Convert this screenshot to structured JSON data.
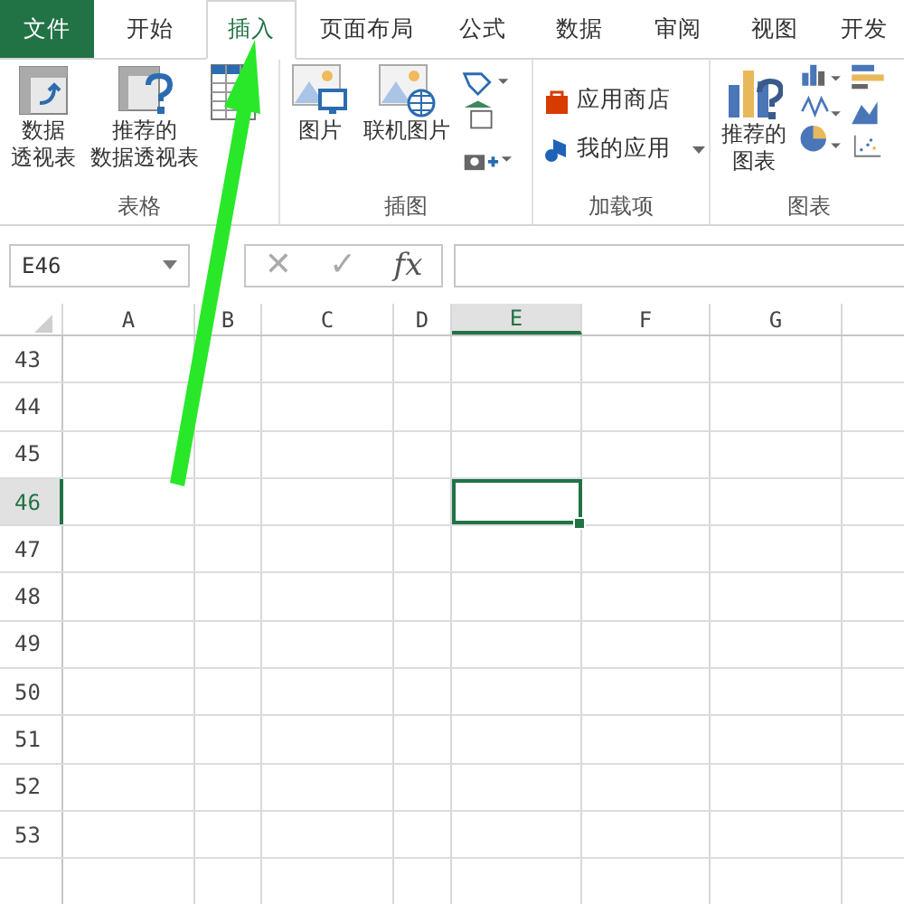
{
  "tabs": [
    {
      "label": "文件",
      "kind": "file",
      "selected": false
    },
    {
      "label": "开始",
      "kind": "tab",
      "selected": false
    },
    {
      "label": "插入",
      "kind": "tab",
      "selected": true
    },
    {
      "label": "页面布局",
      "kind": "tab",
      "selected": false
    },
    {
      "label": "公式",
      "kind": "tab",
      "selected": false
    },
    {
      "label": "数据",
      "kind": "tab",
      "selected": false
    },
    {
      "label": "审阅",
      "kind": "tab",
      "selected": false
    },
    {
      "label": "视图",
      "kind": "tab",
      "selected": false
    },
    {
      "label": "开发",
      "kind": "tab",
      "selected": false
    }
  ],
  "ribbon": [
    {
      "label": "表格",
      "items": [
        {
          "kind": "pivot",
          "lines": [
            "数据",
            "透视表"
          ]
        },
        {
          "kind": "recommended-pivot",
          "lines": [
            "推荐的",
            "数据透视表"
          ]
        },
        {
          "kind": "table"
        }
      ]
    },
    {
      "label": "插图",
      "items": [
        {
          "kind": "picture",
          "lines": [
            "图片"
          ]
        },
        {
          "kind": "online-picture",
          "lines": [
            "联机图片"
          ]
        },
        {
          "kind": "shape-stack"
        }
      ]
    },
    {
      "label": "加载项",
      "items": [
        {
          "kind": "store",
          "lines": [
            "应用商店"
          ]
        },
        {
          "kind": "my-apps",
          "lines": [
            "我的应用"
          ]
        }
      ]
    },
    {
      "label": "图表",
      "items": [
        {
          "kind": "recommended-chart",
          "lines": [
            "推荐的",
            "图表"
          ]
        },
        {
          "kind": "chart-grid"
        }
      ]
    }
  ],
  "name_box": {
    "value": "E46"
  },
  "formula_bar": {
    "cancel": "✕",
    "enter": "✓",
    "function": "fx"
  },
  "columns": [
    {
      "label": "A",
      "selected": false
    },
    {
      "label": "B",
      "selected": false
    },
    {
      "label": "C",
      "selected": false
    },
    {
      "label": "D",
      "selected": false
    },
    {
      "label": "E",
      "selected": true
    },
    {
      "label": "F",
      "selected": false
    },
    {
      "label": "G",
      "selected": false
    }
  ],
  "rows": [
    {
      "label": "43",
      "selected": false
    },
    {
      "label": "44",
      "selected": false
    },
    {
      "label": "45",
      "selected": false
    },
    {
      "label": "46",
      "selected": true
    },
    {
      "label": "47",
      "selected": false
    },
    {
      "label": "48",
      "selected": false
    },
    {
      "label": "49",
      "selected": false
    },
    {
      "label": "50",
      "selected": false
    },
    {
      "label": "51",
      "selected": false
    },
    {
      "label": "52",
      "selected": false
    },
    {
      "label": "53",
      "selected": false
    }
  ]
}
